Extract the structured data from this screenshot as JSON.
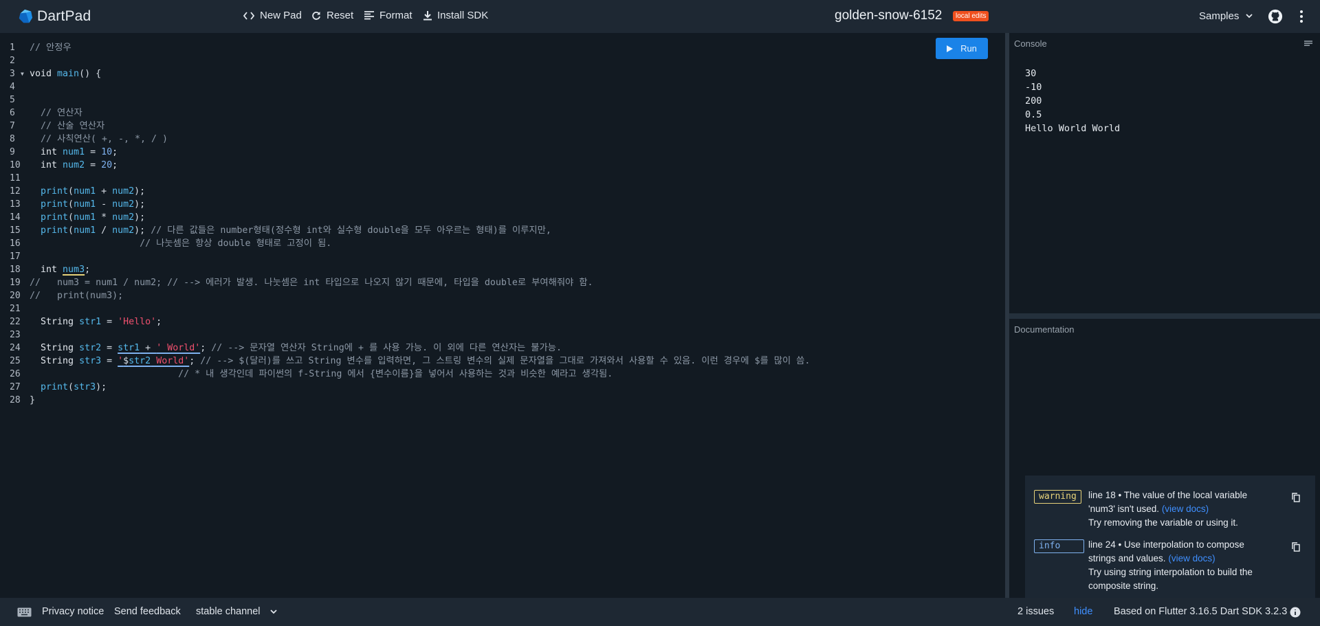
{
  "app": {
    "title": "DartPad",
    "pad_name": "golden-snow-6152",
    "badge": "local edits"
  },
  "toolbar": {
    "new_pad": "New Pad",
    "reset": "Reset",
    "format": "Format",
    "install_sdk": "Install SDK",
    "samples": "Samples"
  },
  "editor": {
    "run_label": "Run",
    "lines": [
      [
        [
          "c",
          "// 안정우"
        ]
      ],
      [],
      [
        [
          "k",
          "void "
        ],
        [
          "f",
          "main"
        ],
        [
          "p",
          "() {"
        ]
      ],
      [],
      [],
      [
        [
          "p",
          "  "
        ],
        [
          "c",
          "// 연산자"
        ]
      ],
      [
        [
          "p",
          "  "
        ],
        [
          "c",
          "// 산술 연산자"
        ]
      ],
      [
        [
          "p",
          "  "
        ],
        [
          "c",
          "// 사칙연산( +, -, *, / )"
        ]
      ],
      [
        [
          "p",
          "  "
        ],
        [
          "k",
          "int "
        ],
        [
          "f",
          "num1"
        ],
        [
          "p",
          " = "
        ],
        [
          "n",
          "10"
        ],
        [
          "p",
          ";"
        ]
      ],
      [
        [
          "p",
          "  "
        ],
        [
          "k",
          "int "
        ],
        [
          "f",
          "num2"
        ],
        [
          "p",
          " = "
        ],
        [
          "n",
          "20"
        ],
        [
          "p",
          ";"
        ]
      ],
      [],
      [
        [
          "p",
          "  "
        ],
        [
          "f",
          "print"
        ],
        [
          "p",
          "("
        ],
        [
          "f",
          "num1"
        ],
        [
          "p",
          " + "
        ],
        [
          "f",
          "num2"
        ],
        [
          "p",
          ");"
        ]
      ],
      [
        [
          "p",
          "  "
        ],
        [
          "f",
          "print"
        ],
        [
          "p",
          "("
        ],
        [
          "f",
          "num1"
        ],
        [
          "p",
          " - "
        ],
        [
          "f",
          "num2"
        ],
        [
          "p",
          ");"
        ]
      ],
      [
        [
          "p",
          "  "
        ],
        [
          "f",
          "print"
        ],
        [
          "p",
          "("
        ],
        [
          "f",
          "num1"
        ],
        [
          "p",
          " * "
        ],
        [
          "f",
          "num2"
        ],
        [
          "p",
          ");"
        ]
      ],
      [
        [
          "p",
          "  "
        ],
        [
          "f",
          "print"
        ],
        [
          "p",
          "("
        ],
        [
          "f",
          "num1"
        ],
        [
          "p",
          " / "
        ],
        [
          "f",
          "num2"
        ],
        [
          "p",
          "); "
        ],
        [
          "c",
          "// 다른 값들은 number형태(정수형 int와 실수형 double을 모두 아우르는 형태)를 이루지만,"
        ]
      ],
      [
        [
          "p",
          "                    "
        ],
        [
          "c",
          "// 나눗셈은 항상 double 형태로 고정이 됨."
        ]
      ],
      [],
      [
        [
          "p",
          "  "
        ],
        [
          "k",
          "int "
        ],
        [
          "u",
          "num3"
        ],
        [
          "p",
          ";"
        ]
      ],
      [
        [
          "c",
          "//   num3 = num1 / num2; // --> 에러가 발생. 나눗셈은 int 타입으로 나오지 않기 때문에, 타입을 double로 부여해줘야 함."
        ]
      ],
      [
        [
          "c",
          "//   print(num3);"
        ]
      ],
      [],
      [
        [
          "p",
          "  "
        ],
        [
          "k",
          "String "
        ],
        [
          "f",
          "str1"
        ],
        [
          "p",
          " = "
        ],
        [
          "s",
          "'Hello'"
        ],
        [
          "p",
          ";"
        ]
      ],
      [],
      [
        [
          "p",
          "  "
        ],
        [
          "k",
          "String "
        ],
        [
          "f",
          "str2"
        ],
        [
          "p",
          " = "
        ],
        [
          "fu",
          "str1"
        ],
        [
          "pu",
          " + "
        ],
        [
          "su",
          "' World'"
        ],
        [
          "p",
          "; "
        ],
        [
          "c",
          "// --> 문자열 연산자 String에 + 를 사용 가능. 이 외에 다른 연산자는 불가능."
        ]
      ],
      [
        [
          "p",
          "  "
        ],
        [
          "k",
          "String "
        ],
        [
          "f",
          "str3"
        ],
        [
          "p",
          " = "
        ],
        [
          "su",
          "'"
        ],
        [
          "pu",
          "$"
        ],
        [
          "fu",
          "str2"
        ],
        [
          "su",
          " World'"
        ],
        [
          "p",
          "; "
        ],
        [
          "c",
          "// --> $(달러)를 쓰고 String 변수를 입력하면, 그 스트링 변수의 실제 문자열을 그대로 가져와서 사용할 수 있음. 이런 경우에 $를 많이 씀."
        ]
      ],
      [
        [
          "p",
          "                           "
        ],
        [
          "c",
          "// * 내 생각인데 파이썬의 f-String 에서 {변수이름}을 넣어서 사용하는 것과 비슷한 예라고 생각됨."
        ]
      ],
      [
        [
          "p",
          "  "
        ],
        [
          "f",
          "print"
        ],
        [
          "p",
          "("
        ],
        [
          "f",
          "str3"
        ],
        [
          "p",
          ");"
        ]
      ],
      [
        [
          "p",
          "}"
        ]
      ]
    ]
  },
  "console": {
    "title": "Console",
    "output": [
      "30",
      "-10",
      "200",
      "0.5",
      "Hello World World"
    ]
  },
  "docs": {
    "title": "Documentation"
  },
  "issues": [
    {
      "severity": "warning",
      "message": "line 18 • The value of the local variable 'num3' isn't used.",
      "link": "(view docs)",
      "fix": "Try removing the variable or using it."
    },
    {
      "severity": "info",
      "message": "line 24 • Use interpolation to compose strings and values.",
      "link": "(view docs)",
      "fix": "Try using string interpolation to build the composite string."
    }
  ],
  "status": {
    "privacy": "Privacy notice",
    "feedback": "Send feedback",
    "channel": "stable channel",
    "issue_count": "2 issues",
    "hide": "hide",
    "version": "Based on Flutter 3.16.5 Dart SDK 3.2.3"
  },
  "colors": {
    "accent": "#1a83e8",
    "badge": "#f0501e",
    "keyword": "#e3e8ee",
    "identifier": "#55b9ec",
    "string": "#f0506e",
    "number": "#7fb2f0",
    "comment": "#8c98a6"
  }
}
